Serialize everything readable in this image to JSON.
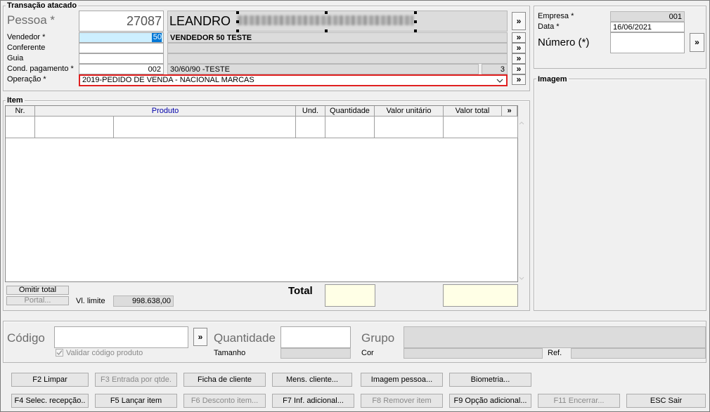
{
  "transacao": {
    "title": "Transação atacado",
    "pessoa_label": "Pessoa *",
    "pessoa_code": "27087",
    "pessoa_name": "LEANDRO",
    "vendedor_label": "Vendedor *",
    "vendedor_code": "50",
    "vendedor_name": "VENDEDOR 50 TESTE",
    "conferente_label": "Conferente",
    "guia_label": "Guia",
    "cond_label": "Cond. pagamento *",
    "cond_code": "002",
    "cond_name": "30/60/90 -TESTE",
    "cond_parcelas": "3",
    "operacao_label": "Operação *",
    "operacao_value": "2019-PEDIDO DE VENDA - NACIONAL MARCAS",
    "more_glyph": "»"
  },
  "empresa": {
    "empresa_label": "Empresa *",
    "empresa_value": "001",
    "data_label": "Data *",
    "data_value": "16/06/2021",
    "numero_label": "Número (*)"
  },
  "imagem": {
    "title": "Imagem"
  },
  "item": {
    "title": "Item",
    "columns": [
      "Nr.",
      "Produto",
      "Und.",
      "Quantidade",
      "Valor unitário",
      "Valor total"
    ],
    "omitir_total": "Omitir total",
    "portal": "Portal...",
    "vl_limite_label": "Vl. limite",
    "vl_limite_value": "998.638,00",
    "total_label": "Total"
  },
  "entrada": {
    "codigo_label": "Código",
    "validar_label": "Validar código produto",
    "quantidade_label": "Quantidade",
    "tamanho_label": "Tamanho",
    "grupo_label": "Grupo",
    "cor_label": "Cor",
    "ref_label": "Ref."
  },
  "buttons_row1": [
    "F2 Limpar",
    "F3 Entrada por qtde.",
    "Ficha de cliente",
    "Mens. cliente...",
    "Imagem pessoa...",
    "Biometria..."
  ],
  "buttons_row2": [
    "F4 Selec. recepção..",
    "F5 Lançar item",
    "F6 Desconto item...",
    "F7 Inf. adicional...",
    "F8 Remover item",
    "F9 Opção adicional...",
    "F11 Encerrar...",
    "ESC Sair"
  ],
  "colors": {
    "highlight": "#cdefff",
    "selection": "#0078d7",
    "operacao_border": "#e02020",
    "total_bg": "#ffffe6"
  },
  "icons": {
    "more": "double-chevron-right-icon",
    "dropdown": "chevron-down-icon",
    "scroll_up": "chevron-up-icon",
    "scroll_down": "chevron-down-icon",
    "checkbox": "checkmark-icon"
  }
}
